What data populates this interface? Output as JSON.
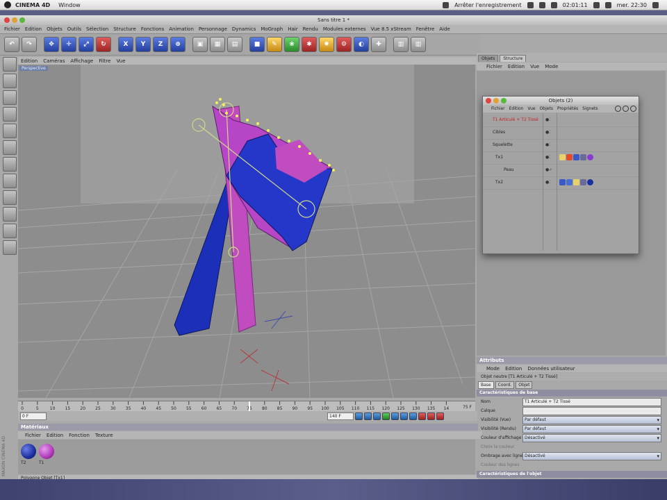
{
  "menubar": {
    "app_name": "CINEMA 4D",
    "menus": [
      "Window"
    ],
    "recording": "Arrêter l'enregistrement",
    "timer": "02:01:11",
    "clock": "mer. 22:30"
  },
  "window": {
    "title": "Sans titre 1 *"
  },
  "app_menu": [
    "Fichier",
    "Edition",
    "Objets",
    "Outils",
    "Sélection",
    "Structure",
    "Fonctions",
    "Animation",
    "Personnage",
    "Dynamics",
    "MoGraph",
    "Hair",
    "Rendu",
    "Modules externes",
    "Vue 8.5 xStream",
    "Fenêtre",
    "Aide"
  ],
  "toolbar": {
    "axis_x": "X",
    "axis_y": "Y",
    "axis_z": "Z"
  },
  "viewport": {
    "menu": [
      "Edition",
      "Caméras",
      "Affichage",
      "Filtre",
      "Vue"
    ],
    "label": "Perspective"
  },
  "timeline": {
    "ticks": [
      "0",
      "5",
      "10",
      "15",
      "20",
      "25",
      "30",
      "35",
      "40",
      "45",
      "50",
      "55",
      "60",
      "65",
      "70",
      "75",
      "80",
      "85",
      "90",
      "95",
      "100",
      "105",
      "110",
      "115",
      "120",
      "125",
      "130",
      "135",
      "14"
    ],
    "current": "75 F",
    "start": "0 F",
    "end": "140 F"
  },
  "materials": {
    "title": "Matériaux",
    "menu": [
      "Fichier",
      "Edition",
      "Fonction",
      "Texture"
    ],
    "items": [
      {
        "label": "T2",
        "color": "#1b2f9e"
      },
      {
        "label": "T1",
        "color": "#b03ab8"
      }
    ],
    "status": "Polygone Objet [Tx1]"
  },
  "maxon": "MAXON CINEMA 4D",
  "right_tabs": [
    "Objets",
    "Structure"
  ],
  "right_menu": [
    "Fichier",
    "Edition",
    "Vue",
    "Mode"
  ],
  "objects_window": {
    "title": "Objets (2)",
    "menu": [
      "Fichier",
      "Edition",
      "Vue",
      "Objets",
      "Propriétés",
      "Signets"
    ],
    "rows": [
      {
        "name": "T1 Articulé + T2 Tissé",
        "highlight": true
      },
      {
        "name": "Cibles",
        "highlight": false
      },
      {
        "name": "Squelette",
        "highlight": false
      },
      {
        "name": "Tx1",
        "highlight": false
      },
      {
        "name": "Peau",
        "highlight": false
      },
      {
        "name": "Tx2",
        "highlight": false
      }
    ]
  },
  "attributes": {
    "title": "Attributs",
    "menu": [
      "Mode",
      "Edition",
      "Données utilisateur"
    ],
    "object": "Objet neutre [T1 Articulé + T2 Tissé]",
    "tabs": [
      "Base",
      "Coord.",
      "Objet"
    ],
    "section_base": "Caractéristiques de base",
    "rows": [
      {
        "label": "Nom",
        "value": "T1 Articulé + T2 Tissé"
      },
      {
        "label": "Calque",
        "value": ""
      },
      {
        "label": "Visibilité (Vue)",
        "value": "Par défaut"
      },
      {
        "label": "Visibilité (Rendu)",
        "value": "Par défaut"
      },
      {
        "label": "Couleur d'affichage",
        "value": "Désactivé"
      },
      {
        "label": "Choix la couleur",
        "value": ""
      },
      {
        "label": "Ombrage avec lignes",
        "value": "Désactivé"
      },
      {
        "label": "Couleur des lignes",
        "value": ""
      }
    ],
    "section_obj": "Caractéristiques de l'objet"
  }
}
